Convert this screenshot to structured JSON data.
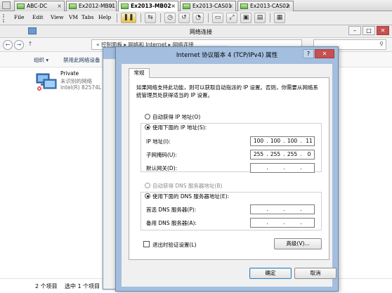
{
  "vm_tabs": [
    {
      "label": "ABC-DC",
      "active": false
    },
    {
      "label": "Ex2012-MB01",
      "active": false
    },
    {
      "label": "Ex2013-MB02",
      "active": true
    },
    {
      "label": "Ex2013-CAS01",
      "active": false
    },
    {
      "label": "Ex2013-CAS02",
      "active": false
    }
  ],
  "vm_menu": {
    "file": "File",
    "edit": "Edit",
    "view": "View",
    "vm": "VM",
    "tabs": "Tabs",
    "help": "Help"
  },
  "explorer": {
    "title": "网络连接",
    "breadcrumb": "« 控制面板 ▸ 网络和 Internet ▸ 网络连接",
    "commands": {
      "organize": "组织 ▾",
      "disable": "禁用此网络设备"
    },
    "connection": {
      "name": "Private",
      "status": "未识别的网络",
      "adapter": "Intel(R) 82574L ..."
    },
    "status": {
      "items": "2 个项目",
      "selected": "选中 1 个项目"
    }
  },
  "dialog": {
    "title": "Internet 协议版本 4 (TCP/IPv4) 属性",
    "help": "?",
    "close": "✕",
    "tab": "常规",
    "description": "如果网络支持此功能，则可以获取自动指派的 IP 设置。否则，你需要从网络系统管理员处获得适当的 IP 设置。",
    "ip_auto_label": "自动获得 IP 地址(O)",
    "ip_manual_label": "使用下面的 IP 地址(S):",
    "ip_address_label": "IP 地址(I):",
    "subnet_label": "子网掩码(U):",
    "gateway_label": "默认网关(D):",
    "ip_address": [
      "100",
      "100",
      "100",
      "11"
    ],
    "subnet": [
      "255",
      "255",
      "255",
      "0"
    ],
    "gateway": [
      "",
      "",
      "",
      ""
    ],
    "dns_auto_label": "自动获得 DNS 服务器地址(B)",
    "dns_manual_label": "使用下面的 DNS 服务器地址(E):",
    "preferred_dns_label": "首选 DNS 服务器(P):",
    "alternate_dns_label": "备用 DNS 服务器(A):",
    "preferred_dns": [
      "",
      "",
      "",
      ""
    ],
    "alternate_dns": [
      "",
      "",
      "",
      ""
    ],
    "validate_label": "退出时验证设置(L)",
    "advanced": "高级(V)...",
    "ok": "确定",
    "cancel": "取消",
    "dot": "."
  }
}
